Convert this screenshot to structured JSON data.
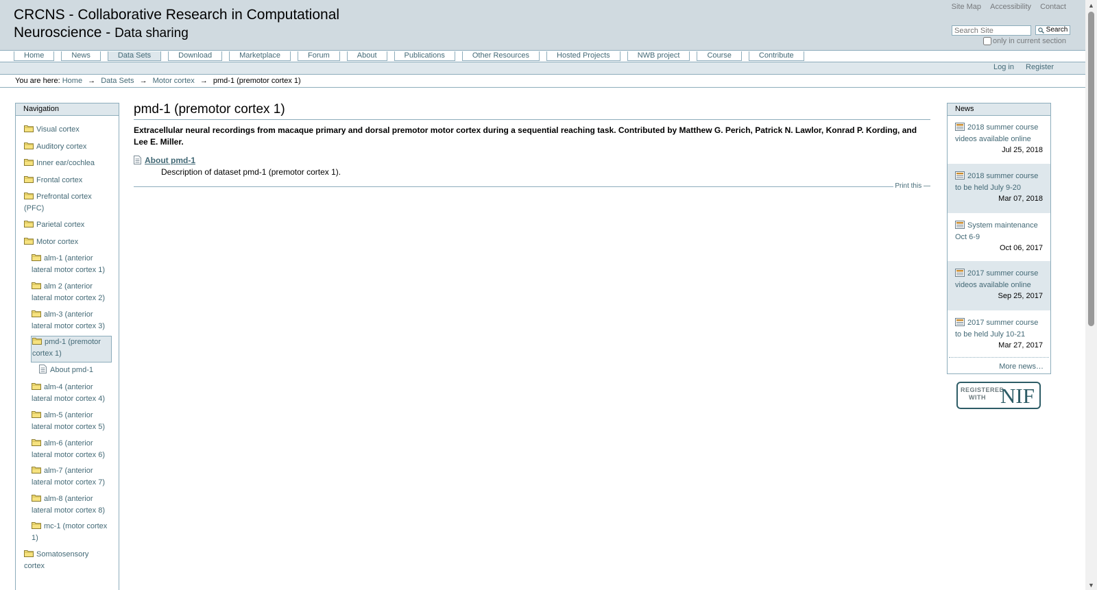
{
  "header": {
    "title_line1": "CRCNS - Collaborative Research in Computational",
    "title_line2_main": "Neuroscience - ",
    "title_line2_sub": "Data sharing",
    "site_actions": [
      "Site Map",
      "Accessibility",
      "Contact"
    ],
    "search_placeholder": "Search Site",
    "search_button": "Search",
    "scope_label": "only in current section"
  },
  "tabs": [
    {
      "label": "Home",
      "selected": false
    },
    {
      "label": "News",
      "selected": false
    },
    {
      "label": "Data Sets",
      "selected": true
    },
    {
      "label": "Download",
      "selected": false
    },
    {
      "label": "Marketplace",
      "selected": false
    },
    {
      "label": "Forum",
      "selected": false
    },
    {
      "label": "About",
      "selected": false
    },
    {
      "label": "Publications",
      "selected": false
    },
    {
      "label": "Other Resources",
      "selected": false
    },
    {
      "label": "Hosted Projects",
      "selected": false
    },
    {
      "label": "NWB project",
      "selected": false
    },
    {
      "label": "Course",
      "selected": false
    },
    {
      "label": "Contribute",
      "selected": false
    }
  ],
  "personal_bar": {
    "login": "Log in",
    "register": "Register"
  },
  "breadcrumbs": {
    "prefix": "You are here:",
    "arrow": "→",
    "items": [
      "Home",
      "Data Sets",
      "Motor cortex"
    ],
    "current": "pmd-1 (premotor cortex 1)"
  },
  "navigation": {
    "header": "Navigation",
    "items": [
      {
        "line1": "Visual cortex",
        "line2": "",
        "level": 1
      },
      {
        "line1": "Auditory cortex",
        "line2": "",
        "level": 1
      },
      {
        "line1": "Inner ear/cochlea",
        "line2": "",
        "level": 1
      },
      {
        "line1": "Frontal cortex",
        "line2": "",
        "level": 1
      },
      {
        "line1": "Prefrontal cortex",
        "line2": "(PFC)",
        "level": 1
      },
      {
        "line1": "Parietal cortex",
        "line2": "",
        "level": 1
      },
      {
        "line1": "Motor cortex",
        "line2": "",
        "level": 1
      },
      {
        "line1": "alm-1 (anterior",
        "line2": "lateral motor cortex 1)",
        "level": 2
      },
      {
        "line1": "alm 2 (anterior",
        "line2": "lateral motor cortex 2)",
        "level": 2
      },
      {
        "line1": "alm-3 (anterior",
        "line2": "lateral motor cortex 3)",
        "level": 2
      },
      {
        "line1": "pmd-1 (premotor",
        "line2": "cortex 1)",
        "level": 2,
        "current": true
      },
      {
        "line1": "About pmd-1",
        "line2": "",
        "level": 3,
        "page": true
      },
      {
        "line1": "alm-4 (anterior",
        "line2": "lateral motor cortex 4)",
        "level": 2
      },
      {
        "line1": "alm-5 (anterior",
        "line2": "lateral motor cortex 5)",
        "level": 2
      },
      {
        "line1": "alm-6 (anterior",
        "line2": "lateral motor cortex 6)",
        "level": 2
      },
      {
        "line1": "alm-7 (anterior",
        "line2": "lateral motor cortex 7)",
        "level": 2
      },
      {
        "line1": "alm-8 (anterior",
        "line2": "lateral motor cortex 8)",
        "level": 2
      },
      {
        "line1": "mc-1 (motor cortex",
        "line2": "1)",
        "level": 2
      },
      {
        "line1": "Somatosensory",
        "line2": "cortex",
        "level": 1
      }
    ]
  },
  "content": {
    "title": "pmd-1 (premotor cortex 1)",
    "description": "Extracellular neural recordings from macaque primary and dorsal premotor motor cortex during a sequential reaching task. Contributed by Matthew G. Perich, Patrick N. Lawlor, Konrad P. Kording, and Lee E. Miller.",
    "item_title": "About pmd-1",
    "item_description": "Description of dataset pmd-1 (premotor cortex 1).",
    "print_link": "Print this —"
  },
  "news": {
    "header": "News",
    "items": [
      {
        "title1": "2018 summer course",
        "title2": "videos available online",
        "date": "Jul 25, 2018"
      },
      {
        "title1": "2018 summer course",
        "title2": "to be held July 9-20",
        "date": "Mar 07, 2018"
      },
      {
        "title1": "System maintenance",
        "title2": "Oct 6-9",
        "date": "Oct 06, 2017"
      },
      {
        "title1": "2017 summer course",
        "title2": "videos available online",
        "date": "Sep 25, 2017"
      },
      {
        "title1": "2017 summer course",
        "title2": "to be held July 10-21",
        "date": "Mar 27, 2017"
      }
    ],
    "more": "More news…"
  },
  "nif_logo": {
    "small_line1": "REGISTERED",
    "small_line2": "WITH",
    "big": "NIF"
  },
  "colors": {
    "accent": "#436976",
    "border": "#8cacbb",
    "header_bg": "#d0dae0",
    "highlight": "#dee7ec"
  }
}
